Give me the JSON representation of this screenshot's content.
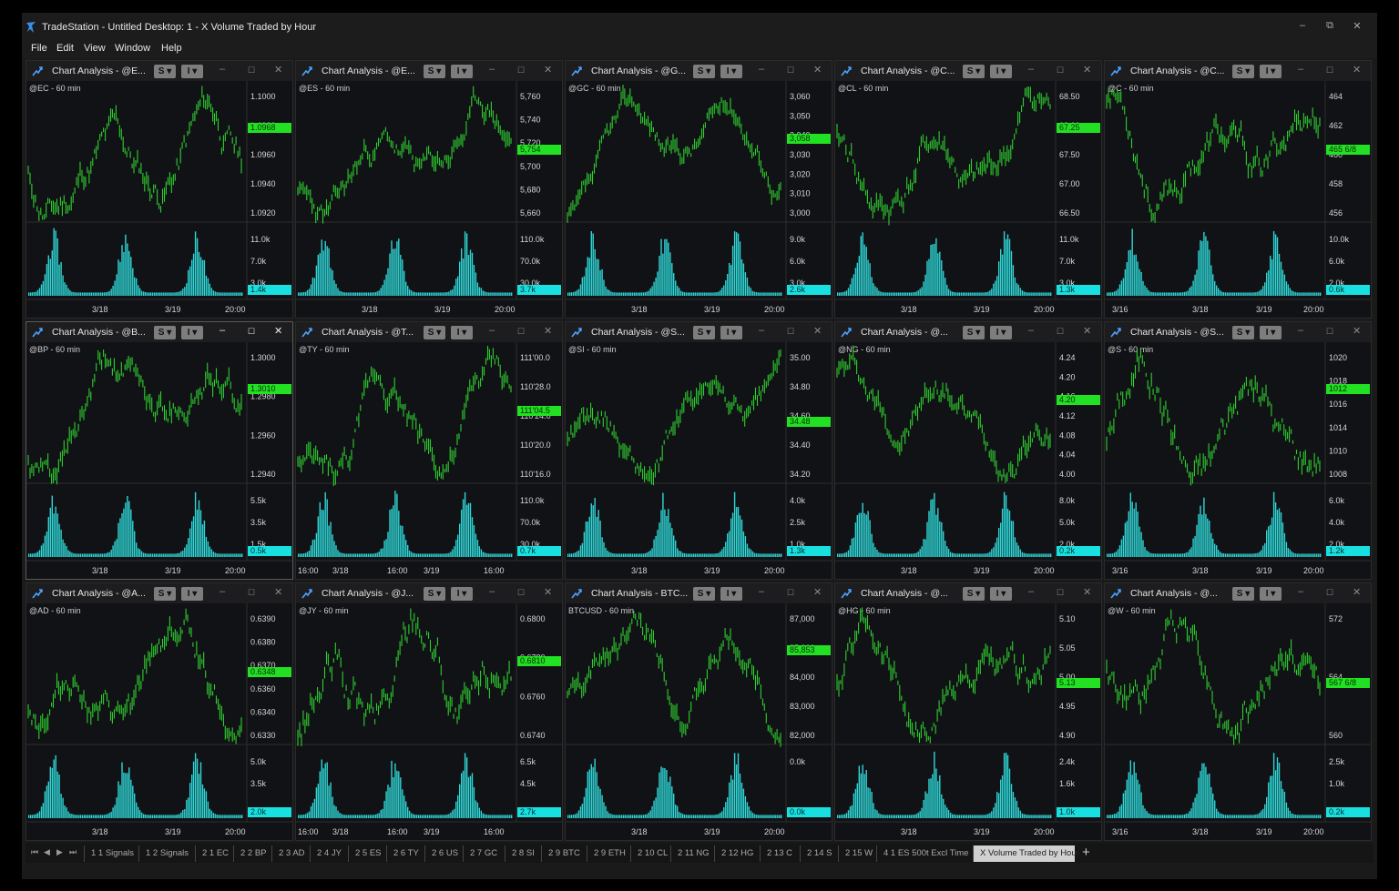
{
  "window": {
    "title": "TradeStation  - Untitled Desktop: 1 - X Volume Traded by Hour",
    "controls": {
      "minimize": "–",
      "restore": "⧉",
      "close": "✕"
    }
  },
  "menu": [
    "File",
    "Edit",
    "View",
    "Window",
    "Help"
  ],
  "colors": {
    "price_bar": "#2fcf2f",
    "volume_bar": "#2fd6d6",
    "last_price_tag": "#22e022",
    "last_volume_tag": "#19e0e0"
  },
  "panel_buttons": {
    "strategy": "S ▾",
    "indicator": "I ▾"
  },
  "panels": [
    {
      "title": "Chart Analysis - @E...",
      "label": "@EC - 60 min",
      "price_ticks": [
        "1.1000",
        "1.0980",
        "1.0960",
        "1.0940",
        "1.0920"
      ],
      "last_price": "1.0968",
      "vol_ticks": [
        "11.0k",
        "7.0k",
        "3.0k"
      ],
      "last_vol": "1.4k",
      "time_labels": [
        "3/18",
        "3/19",
        "20:00"
      ],
      "seed": 11
    },
    {
      "title": "Chart Analysis - @E...",
      "label": "@ES - 60 min",
      "price_ticks": [
        "5,760",
        "5,740",
        "5,720",
        "5,700",
        "5,680",
        "5,660"
      ],
      "last_price": "5,754",
      "vol_ticks": [
        "110.0k",
        "70.0k",
        "30.0k"
      ],
      "last_vol": "3.7k",
      "time_labels": [
        "3/18",
        "3/19",
        "20:00"
      ],
      "seed": 23
    },
    {
      "title": "Chart Analysis - @G...",
      "label": "@GC - 60 min",
      "price_ticks": [
        "3,060",
        "3,050",
        "3,040",
        "3,030",
        "3,020",
        "3,010",
        "3,000"
      ],
      "last_price": "3,058",
      "vol_ticks": [
        "9.0k",
        "6.0k",
        "3.0k"
      ],
      "last_vol": "2.6k",
      "time_labels": [
        "3/18",
        "3/19",
        "20:00"
      ],
      "seed": 37
    },
    {
      "title": "Chart Analysis - @C...",
      "label": "@CL - 60 min",
      "price_ticks": [
        "68.50",
        "68.00",
        "67.50",
        "67.00",
        "66.50"
      ],
      "last_price": "67.25",
      "vol_ticks": [
        "11.0k",
        "7.0k",
        "3.0k"
      ],
      "last_vol": "1.3k",
      "time_labels": [
        "3/18",
        "3/19",
        "20:00"
      ],
      "seed": 41
    },
    {
      "title": "Chart Analysis - @C...",
      "label": "@C - 60 min",
      "price_ticks": [
        "464",
        "462",
        "460",
        "458",
        "456"
      ],
      "last_price": "465 6/8",
      "vol_ticks": [
        "10.0k",
        "6.0k",
        "2.0k"
      ],
      "last_vol": "0.6k",
      "time_labels": [
        "3/16",
        "3/18",
        "3/19",
        "20:00"
      ],
      "seed": 53
    },
    {
      "title": "Chart Analysis - @B...",
      "label": "@BP - 60 min",
      "price_ticks": [
        "1.3000",
        "1.2980",
        "1.2960",
        "1.2940"
      ],
      "last_price": "1.3010",
      "vol_ticks": [
        "5.5k",
        "3.5k",
        "1.5k"
      ],
      "last_vol": "0.5k",
      "time_labels": [
        "3/18",
        "3/19",
        "20:00"
      ],
      "seed": 61
    },
    {
      "title": "Chart Analysis - @T...",
      "label": "@TY - 60 min",
      "price_ticks": [
        "111'00.0",
        "110'28.0",
        "110'24.0",
        "110'20.0",
        "110'16.0"
      ],
      "last_price": "111'04.5",
      "vol_ticks": [
        "110.0k",
        "70.0k",
        "30.0k"
      ],
      "last_vol": "0.7k",
      "time_labels": [
        "16:00",
        "3/18",
        "16:00",
        "3/19",
        "16:00"
      ],
      "seed": 73
    },
    {
      "title": "Chart Analysis - @S...",
      "label": "@SI - 60 min",
      "price_ticks": [
        "35.00",
        "34.80",
        "34.60",
        "34.40",
        "34.20"
      ],
      "last_price": "34.48",
      "vol_ticks": [
        "4.0k",
        "2.5k",
        "1.0k"
      ],
      "last_vol": "1.3k",
      "time_labels": [
        "3/18",
        "3/19",
        "20:00"
      ],
      "seed": 89
    },
    {
      "title": "Chart Analysis - @...",
      "label": "@NG - 60 min",
      "price_ticks": [
        "4.24",
        "4.20",
        "4.16",
        "4.12",
        "4.08",
        "4.04",
        "4.00"
      ],
      "last_price": "4.20",
      "vol_ticks": [
        "8.0k",
        "5.0k",
        "2.0k"
      ],
      "last_vol": "0.2k",
      "time_labels": [
        "3/18",
        "3/19",
        "20:00"
      ],
      "seed": 97
    },
    {
      "title": "Chart Analysis - @S...",
      "label": "@S - 60 min",
      "price_ticks": [
        "1020",
        "1018",
        "1016",
        "1014",
        "1010",
        "1008"
      ],
      "last_price": "1012",
      "vol_ticks": [
        "6.0k",
        "4.0k",
        "2.0k"
      ],
      "last_vol": "1.2k",
      "time_labels": [
        "3/16",
        "3/18",
        "3/19",
        "20:00"
      ],
      "seed": 101
    },
    {
      "title": "Chart Analysis - @A...",
      "label": "@AD - 60 min",
      "price_ticks": [
        "0.6390",
        "0.6380",
        "0.6370",
        "0.6360",
        "0.6340",
        "0.6330"
      ],
      "last_price": "0.6348",
      "vol_ticks": [
        "5.0k",
        "3.5k"
      ],
      "last_vol": "2.0k",
      "time_labels": [
        "3/18",
        "3/19",
        "20:00"
      ],
      "seed": 113
    },
    {
      "title": "Chart Analysis - @J...",
      "label": "@JY - 60 min",
      "price_ticks": [
        "0.6800",
        "0.6780",
        "0.6760",
        "0.6740"
      ],
      "last_price": "0.6810",
      "vol_ticks": [
        "6.5k",
        "4.5k"
      ],
      "last_vol": "2.7k",
      "time_labels": [
        "16:00",
        "3/18",
        "16:00",
        "3/19",
        "16:00"
      ],
      "seed": 127
    },
    {
      "title": "Chart Analysis - BTC...",
      "label": "BTCUSD - 60 min",
      "price_ticks": [
        "87,000",
        "85,000",
        "84,000",
        "83,000",
        "82,000"
      ],
      "last_price": "85,853",
      "vol_ticks": [
        "0.0k"
      ],
      "last_vol": "0.0k",
      "time_labels": [
        "3/18",
        "3/19",
        "20:00"
      ],
      "seed": 131
    },
    {
      "title": "Chart Analysis - @...",
      "label": "@HG - 60 min",
      "price_ticks": [
        "5.10",
        "5.05",
        "5.00",
        "4.95",
        "4.90"
      ],
      "last_price": "5.13",
      "vol_ticks": [
        "2.4k",
        "1.6k"
      ],
      "last_vol": "1.0k",
      "time_labels": [
        "3/18",
        "3/19",
        "20:00"
      ],
      "seed": 139
    },
    {
      "title": "Chart Analysis - @...",
      "label": "@W - 60 min",
      "price_ticks": [
        "572",
        "564",
        "560"
      ],
      "last_price": "567 6/8",
      "vol_ticks": [
        "2.5k",
        "1.0k"
      ],
      "last_vol": "0.2k",
      "time_labels": [
        "3/16",
        "3/18",
        "3/19",
        "20:00"
      ],
      "seed": 149
    }
  ],
  "tabs": [
    "1 1 Signals",
    "1 2 Signals",
    "2 1 EC",
    "2 2 BP",
    "2 3 AD",
    "2 4 JY",
    "2 5 ES",
    "2 6 TY",
    "2 6 US",
    "2 7 GC",
    "2 8 SI",
    "2 9 BTC",
    "2 9 ETH",
    "2 10 CL",
    "2 11 NG",
    "2 12 HG",
    "2 13 C",
    "2 14 S",
    "2 15 W",
    "4 1 ES 500t Excl Time",
    "X Volume Traded by Hour"
  ],
  "tab_nav": [
    "⏮",
    "◀",
    "▶",
    "⏭"
  ],
  "add_tab": "+"
}
